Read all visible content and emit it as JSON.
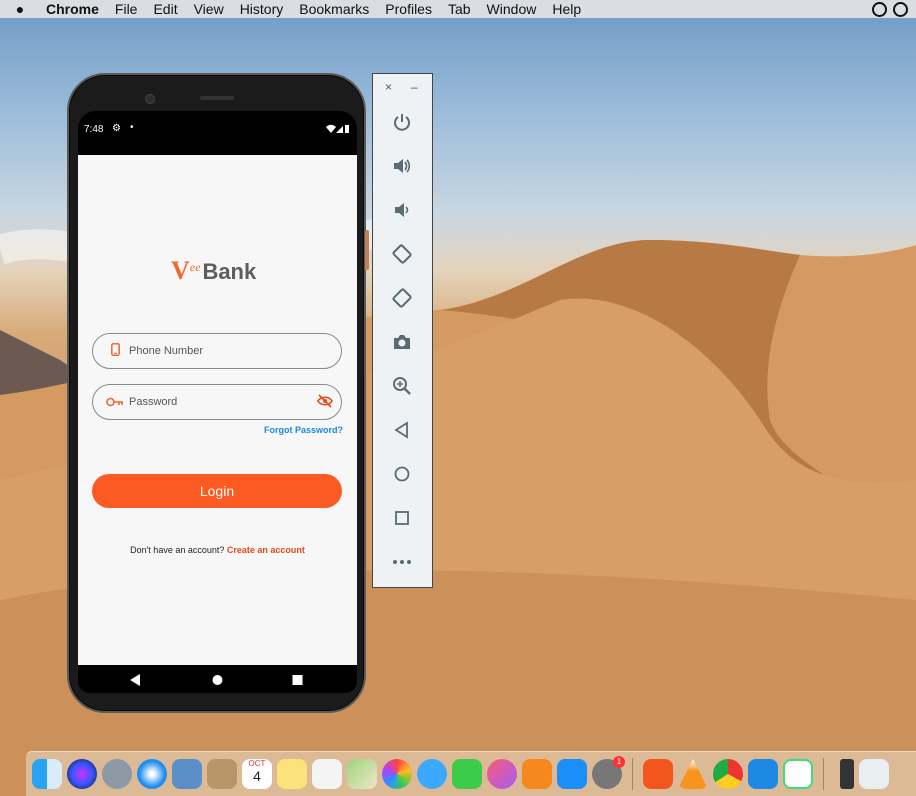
{
  "menubar": {
    "app": "Chrome",
    "items": [
      "File",
      "Edit",
      "View",
      "History",
      "Bookmarks",
      "Profiles",
      "Tab",
      "Window",
      "Help"
    ]
  },
  "phone": {
    "status_time": "7:48",
    "app": {
      "logo_main": "V",
      "logo_ee": "ee",
      "logo_bank": "Bank",
      "phone_placeholder": "Phone Number",
      "password_placeholder": "Password",
      "forgot_label": "Forgot Password?",
      "login_label": "Login",
      "signup_text": "Don't have an account?",
      "signup_link": "Create an account"
    },
    "colors": {
      "accent": "#fb5a23",
      "link": "#1e88e5"
    }
  },
  "emulator_toolbar": {
    "close_label": "×",
    "minimize_label": "–",
    "buttons": [
      "power-icon",
      "volume-up-icon",
      "volume-down-icon",
      "rotate-left-icon",
      "rotate-right-icon",
      "camera-icon",
      "zoom-icon",
      "back-icon",
      "home-icon",
      "overview-icon",
      "more-icon"
    ]
  },
  "dock": {
    "calendar_month": "OCT",
    "calendar_day": "4",
    "system_prefs_badge": "1"
  }
}
